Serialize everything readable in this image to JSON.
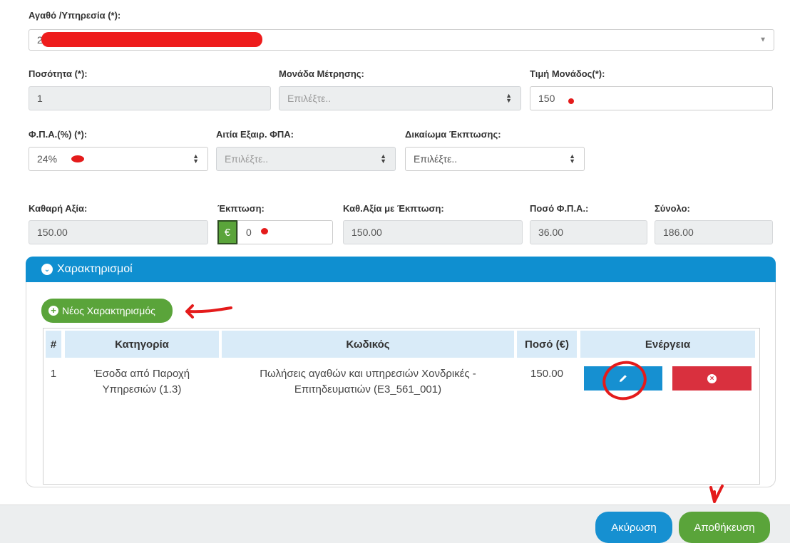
{
  "item": {
    "label": "Αγαθό /Υπηρεσία (*):",
    "value": "2"
  },
  "quantity": {
    "label": "Ποσότητα (*):",
    "value": "1"
  },
  "unit": {
    "label": "Μονάδα Μέτρησης:",
    "placeholder": "Επιλέξτε.."
  },
  "unit_price": {
    "label": "Τιμή Μονάδος(*):",
    "value": "150"
  },
  "vat_percent": {
    "label": "Φ.Π.Α.(%) (*):",
    "value": "24%"
  },
  "vat_exemption": {
    "label": "Αιτία Εξαιρ. ΦΠΑ:",
    "placeholder": "Επιλέξτε.."
  },
  "discount_right": {
    "label": "Δικαίωμα Έκπτωσης:",
    "value": "Επιλέξτε.."
  },
  "totals": {
    "net_label": "Καθαρή Αξία:",
    "net_value": "150.00",
    "discount_label": "Έκπτωση:",
    "discount_symbol": "€",
    "discount_value": "0",
    "net_after_label": "Καθ.Αξία με Έκπτωση:",
    "net_after_value": "150.00",
    "vat_amount_label": "Ποσό Φ.Π.Α.:",
    "vat_amount_value": "36.00",
    "total_label": "Σύνολο:",
    "total_value": "186.00"
  },
  "characterizations": {
    "title": "Χαρακτηρισμοί",
    "new_button": "Νέος Χαρακτηρισμός",
    "columns": [
      "#",
      "Κατηγορία",
      "Κωδικός",
      "Ποσό (€)",
      "Ενέργεια"
    ],
    "rows": [
      {
        "num": "1",
        "category_line1": "Έσοδα από Παροχή",
        "category_line2": "Υπηρεσιών (1.3)",
        "code_line1": "Πωλήσεις αγαθών και υπηρεσιών Χονδρικές -",
        "code_line2": "Επιτηδευματιών (E3_561_001)",
        "amount": "150.00"
      }
    ]
  },
  "footer": {
    "cancel": "Ακύρωση",
    "save": "Αποθήκευση"
  },
  "colors": {
    "primary": "#1690d1",
    "success": "#5aa43a",
    "danger": "#d9303e",
    "annotation": "#e41b1b"
  }
}
